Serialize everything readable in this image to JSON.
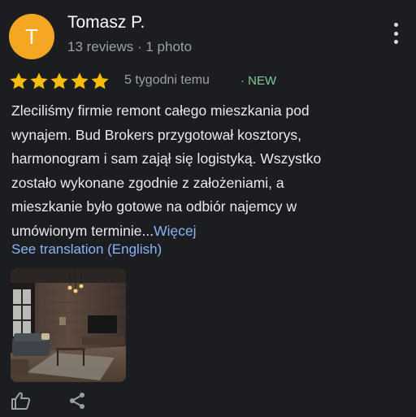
{
  "review": {
    "avatar_letter": "T",
    "avatar_color": "#f5a623",
    "author_name": "Tomasz P.",
    "author_meta": "13 reviews · 1 photo",
    "rating": 5,
    "max_rating": 5,
    "star_color": "#fbbc04",
    "time_ago": "5 tygodni temu",
    "new_badge": "· NEW",
    "text_lines": [
      "Zleciliśmy firmie remont całego mieszkania pod",
      "wynajem. Bud Brokers przygotował kosztorys,",
      "harmonogram i sam zajął się logistyką. Wszystko",
      "zostało wykonane zgodnie z założeniami, a",
      "mieszkanie było gotowe na odbiór najemcy w"
    ],
    "text_last_line": "umówionym terminie...",
    "more_link": "Więcej",
    "translate_link": "See translation (English)"
  },
  "icons": {
    "menu": "more-vert-icon",
    "star": "star-icon",
    "like": "thumb-up-icon",
    "share": "share-icon"
  },
  "colors": {
    "background": "#1c1d20",
    "link": "#8ab4f8",
    "new_badge": "#81c995",
    "muted": "#9aa0a6"
  }
}
